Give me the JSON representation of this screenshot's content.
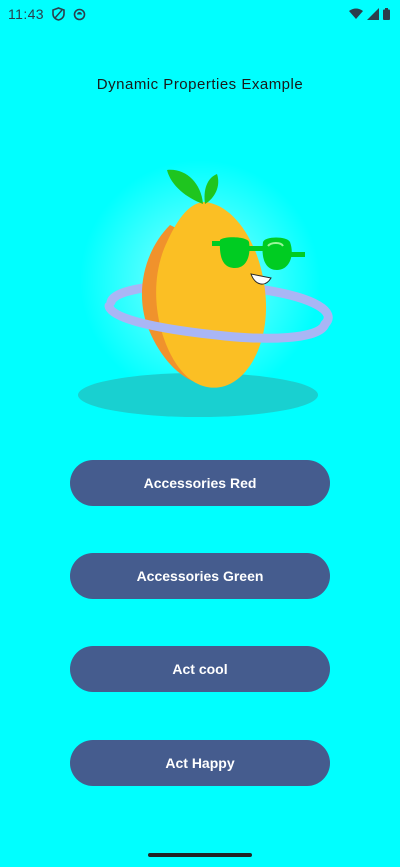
{
  "status_bar": {
    "time": "11:43",
    "left_icons": [
      "shield-icon",
      "sync-icon"
    ],
    "right_icons": [
      "wifi-icon",
      "signal-icon",
      "battery-icon"
    ]
  },
  "screen": {
    "title": "Dynamic Properties Example",
    "background_color": "#00ffff"
  },
  "mascot": {
    "icon": "lemon-mascot-with-sunglasses"
  },
  "buttons": [
    {
      "label": "Accessories Red"
    },
    {
      "label": "Accessories Green"
    },
    {
      "label": "Act cool"
    },
    {
      "label": "Act Happy"
    }
  ],
  "colors": {
    "button_bg": "#455c8e",
    "button_text": "#ffffff",
    "lemon": "#fbbf24",
    "sunglasses": "#00cc22",
    "hoop": "#a5b4fc"
  }
}
